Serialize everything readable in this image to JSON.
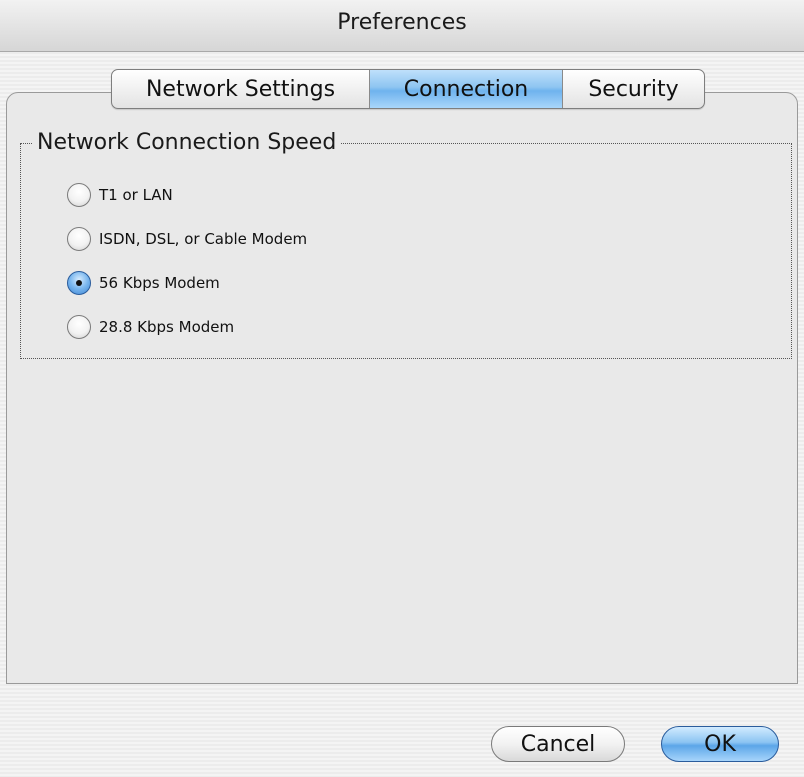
{
  "window": {
    "title": "Preferences"
  },
  "tabs": [
    {
      "label": "Network Settings",
      "selected": false
    },
    {
      "label": "Connection",
      "selected": true
    },
    {
      "label": "Security",
      "selected": false
    }
  ],
  "group": {
    "legend": "Network Connection Speed",
    "options": [
      {
        "label": "T1 or LAN",
        "selected": false
      },
      {
        "label": "ISDN, DSL, or Cable Modem",
        "selected": false
      },
      {
        "label": "56 Kbps Modem",
        "selected": true
      },
      {
        "label": "28.8 Kbps Modem",
        "selected": false
      }
    ]
  },
  "buttons": {
    "cancel": "Cancel",
    "ok": "OK"
  },
  "colors": {
    "accent_blue": "#6fb3ee",
    "selected_radio": "#3e86d4",
    "window_bg": "#ececec"
  }
}
